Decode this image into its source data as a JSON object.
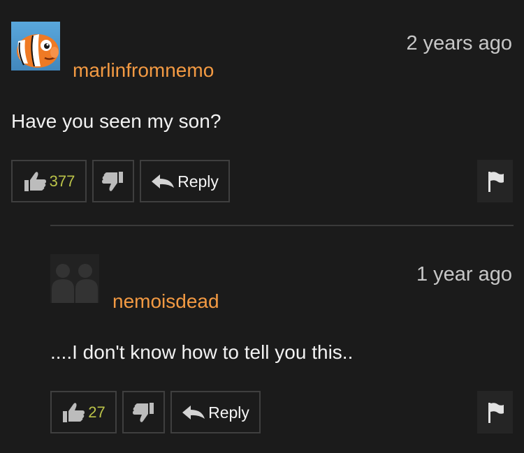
{
  "comments": [
    {
      "username": "marlinfromnemo",
      "timestamp": "2 years ago",
      "text": "Have you seen my son?",
      "likes": "377",
      "reply_label": "Reply",
      "avatar_icon": "clownfish-avatar-icon"
    },
    {
      "username": "nemoisdead",
      "timestamp": "1 year ago",
      "text": "....I don't know how to tell you this..",
      "likes": "27",
      "reply_label": "Reply",
      "avatar_icon": "default-avatar-icon"
    }
  ],
  "colors": {
    "background": "#1b1b1b",
    "username": "#f39a43",
    "count": "#bbc349",
    "border": "#3f3f3f"
  }
}
